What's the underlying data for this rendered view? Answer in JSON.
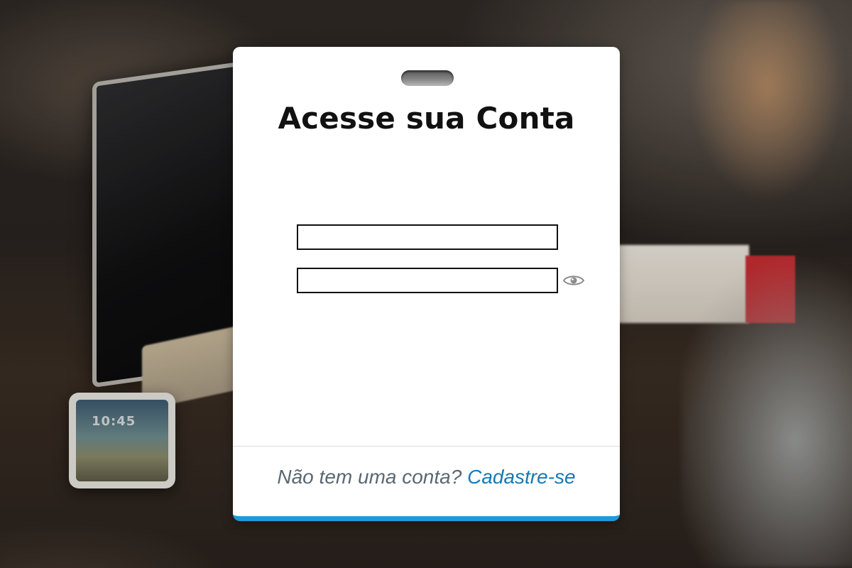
{
  "background": {
    "phone_time": "10:45"
  },
  "login": {
    "title": "Acesse sua Conta",
    "username_value": "",
    "password_value": "",
    "password_toggle_icon": "eye-icon",
    "footer_question": "Não tem uma conta?",
    "footer_link": "Cadastre-se"
  },
  "colors": {
    "accent": "#1e9ad6",
    "link": "#1679b5",
    "footer_text": "#5a6872"
  }
}
